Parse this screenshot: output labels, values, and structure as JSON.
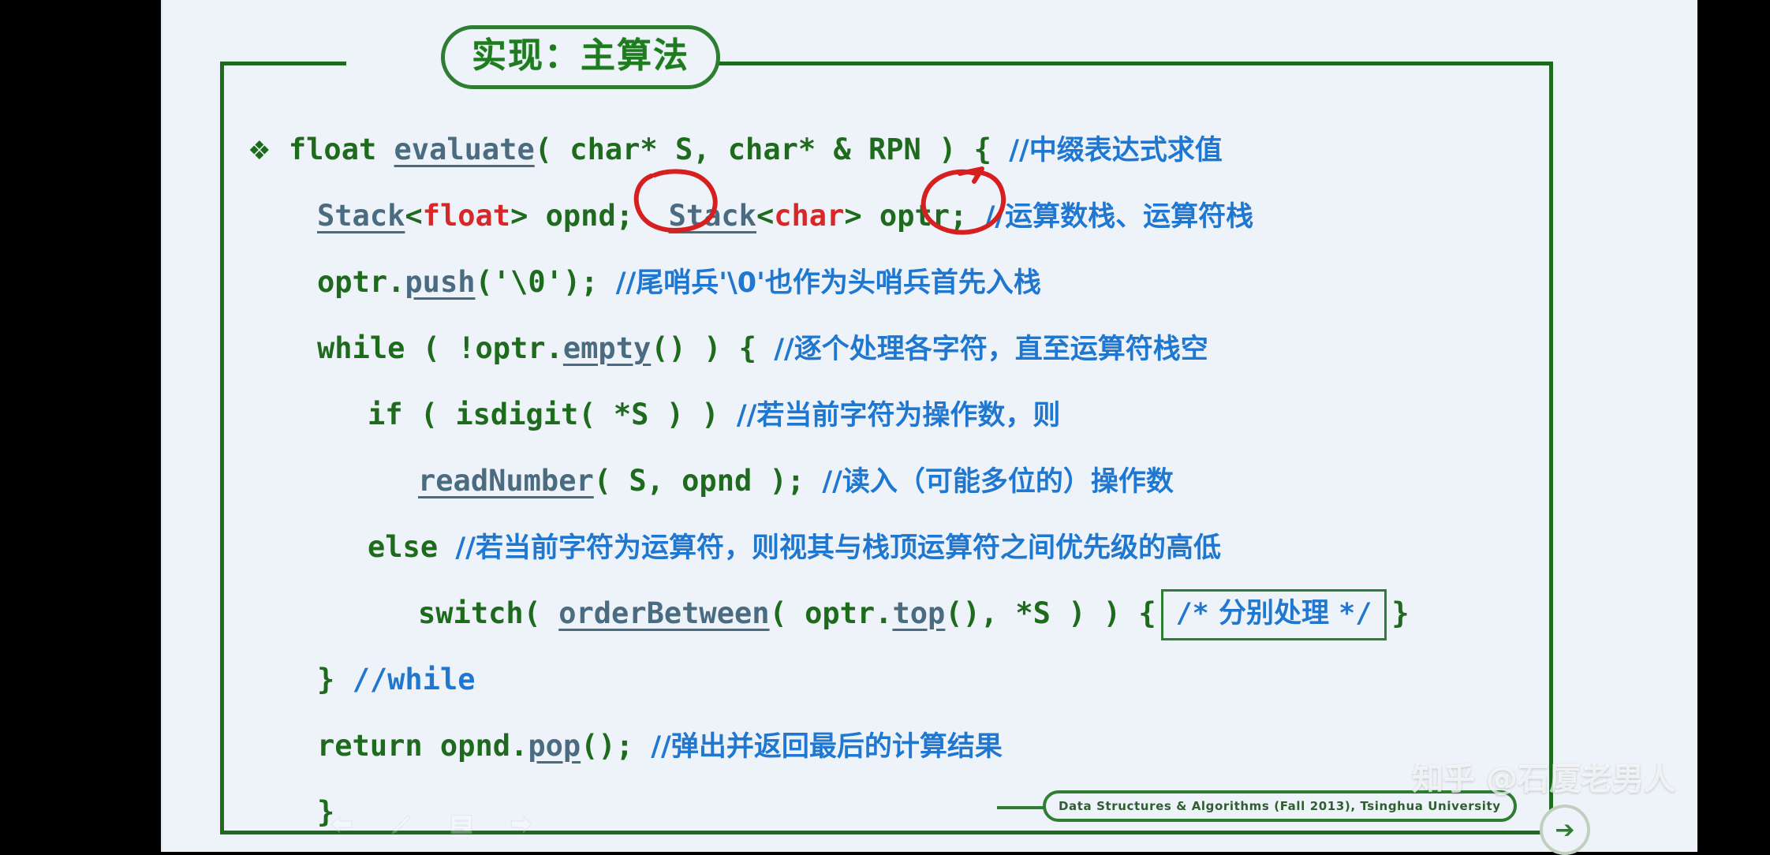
{
  "slide": {
    "title": "实现：主算法",
    "footer_note": "Data Structures & Algorithms (Fall 2013), Tsinghua University",
    "watermark": "知乎 @石厦老男人"
  },
  "code": {
    "l1": {
      "bullet": "❖",
      "kw1": "float ",
      "fn": "evaluate",
      "rest": "( char* S, char* & RPN ) {",
      "comment": "//中缀表达式求值"
    },
    "l2": {
      "fn1": "Stack",
      "lt": "<",
      "type1": "float",
      "gt": "> ",
      "var1": "opnd;",
      "fn2": "Stack",
      "type2": "char",
      "var2": "optr;",
      "comment": "//运算数栈、运算符栈"
    },
    "l3": {
      "obj": "optr.",
      "fn": "push",
      "rest": "('\\0');",
      "comment": "//尾哨兵'\\0'也作为头哨兵首先入栈"
    },
    "l4": {
      "kw": "while ( !optr.",
      "fn": "empty",
      "rest": "() ) {",
      "comment": "//逐个处理各字符，直至运算符栈空"
    },
    "l5": {
      "code": "if ( isdigit( *S ) )",
      "comment": "//若当前字符为操作数，则"
    },
    "l6": {
      "fn": "readNumber",
      "rest": "( S, opnd );",
      "comment": "//读入（可能多位的）操作数"
    },
    "l7": {
      "kw": "else",
      "comment": "//若当前字符为运算符，则视其与栈顶运算符之间优先级的高低"
    },
    "l8": {
      "pre": "switch( ",
      "fn1": "orderBetween",
      "mid": "( optr.",
      "fn2": "top",
      "post": "(), *S ) ) {",
      "boxed_open": "/*",
      "boxed_text": "分别处理",
      "boxed_close": "*/",
      "tail": "}"
    },
    "l9": {
      "brace": "}",
      "comment": "//while"
    },
    "l10": {
      "pre": "return opnd.",
      "fn": "pop",
      "rest": "();",
      "comment": "//弹出并返回最后的计算结果"
    },
    "l11": {
      "brace": "}"
    }
  },
  "toolbar": {
    "back_icon": "back-arrow-icon",
    "pen_icon": "pen-icon",
    "list_icon": "list-icon",
    "forward_icon": "forward-arrow-icon",
    "next_label": "➔"
  },
  "colors": {
    "code_green": "#1e6b1e",
    "comment_blue": "#1f77d0",
    "type_red": "#d62828",
    "function_slate": "#4a6b80",
    "annotation_red": "#d62020",
    "slide_bg": "#eef3fa"
  }
}
